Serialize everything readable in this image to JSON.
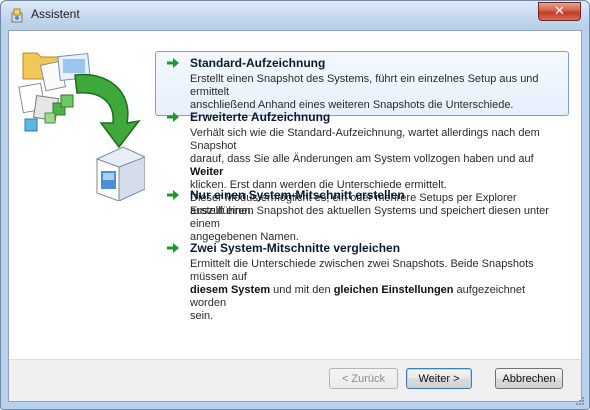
{
  "window": {
    "title": "Assistent",
    "close_label": "✕"
  },
  "options": [
    {
      "title": "Standard-Aufzeichnung",
      "selected": true,
      "desc_lines": [
        "Erstellt einen Snapshot des Systems, führt ein einzelnes Setup aus und ermittelt",
        "anschließend Anhand eines weiteren Snapshots die Unterschiede."
      ]
    },
    {
      "title": "Erweiterte Aufzeichnung",
      "selected": false,
      "desc": {
        "l1": "Verhält sich wie die Standard-Aufzeichnung, wartet allerdings nach dem Snapshot",
        "l2_pre": "darauf, dass Sie alle Änderungen am System vollzogen haben und auf ",
        "l2_bold": "Weiter",
        "l3": "klicken. Erst dann werden die Unterschiede ermittelt.",
        "l4": "Dieser Modus ermöglicht es, ein oder mehrere Setups per Explorer auszuführen."
      }
    },
    {
      "title": "Nur einen System-Mitschnitt erstellen",
      "selected": false,
      "desc_lines": [
        "Erstellt einen Snapshot des aktuellen Systems und speichert diesen unter einem",
        "angegebenen Namen."
      ]
    },
    {
      "title": "Zwei System-Mitschnitte vergleichen",
      "selected": false,
      "desc": {
        "l1": "Ermittelt die Unterschiede zwischen zwei Snapshots. Beide Snapshots müssen auf",
        "l2_bold1": "diesem System",
        "l2_mid": " und mit den ",
        "l2_bold2": "gleichen Einstellungen",
        "l2_post": " aufgezeichnet worden",
        "l3": "sein."
      }
    }
  ],
  "buttons": {
    "back": "< Zurück",
    "next": "Weiter >",
    "cancel": "Abbrechen"
  },
  "icons": {
    "app": "installer-icon",
    "arrow": "green-arrow-icon",
    "illustration": "files-to-package-illustration"
  },
  "colors": {
    "accent_arrow": "#1e9a2a",
    "selection_border": "#7da2ce"
  }
}
